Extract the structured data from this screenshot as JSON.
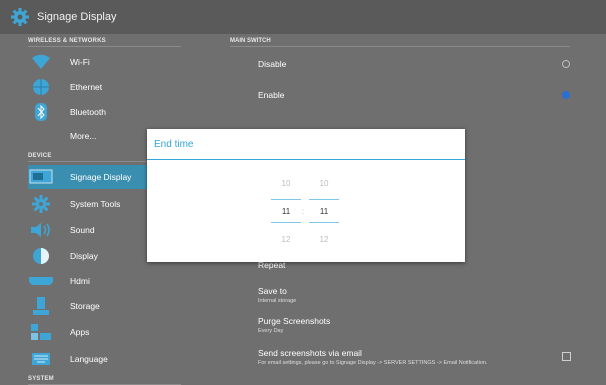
{
  "window": {
    "title": "Signage Display",
    "app_icon": "gear-icon",
    "accent": "#33a5d6"
  },
  "sidebar": {
    "sections": [
      {
        "label": "WIRELESS & NETWORKS"
      },
      {
        "label": "DEVICE"
      },
      {
        "label": "SYSTEM"
      }
    ],
    "items": [
      {
        "label": "Wi-Fi",
        "icon": "wifi-icon"
      },
      {
        "label": "Ethernet",
        "icon": "globe-icon"
      },
      {
        "label": "Bluetooth",
        "icon": "bluetooth-icon"
      },
      {
        "label": "More..."
      },
      {
        "label": "Signage Display",
        "icon": "monitor-icon",
        "active": true
      },
      {
        "label": "System Tools",
        "icon": "gear-icon"
      },
      {
        "label": "Sound",
        "icon": "speaker-icon"
      },
      {
        "label": "Display",
        "icon": "brightness-icon"
      },
      {
        "label": "Hdmi",
        "icon": "hdmi-icon"
      },
      {
        "label": "Storage",
        "icon": "storage-icon"
      },
      {
        "label": "Apps",
        "icon": "apps-icon"
      },
      {
        "label": "Language",
        "icon": "keyboard-icon"
      }
    ]
  },
  "main": {
    "section": "MAIN SWITCH",
    "disable_label": "Disable",
    "enable_label": "Enable",
    "selected": "Enable",
    "repeat_label": "Repeat",
    "save_to": {
      "title": "Save to",
      "subtitle": "Internal storage"
    },
    "purge": {
      "title": "Purge Screenshots",
      "subtitle": "Every Day"
    },
    "email": {
      "title": "Send screenshots via email",
      "subtitle": "For email settings, please go to Signage Display -> SERVER SETTINGS -> Email Notification.",
      "checked": false
    }
  },
  "dialog": {
    "title": "End time",
    "hours": {
      "prev": "10",
      "current": "11",
      "next": "12"
    },
    "separator": ":",
    "minutes": {
      "prev": "10",
      "current": "11",
      "next": "12"
    }
  }
}
